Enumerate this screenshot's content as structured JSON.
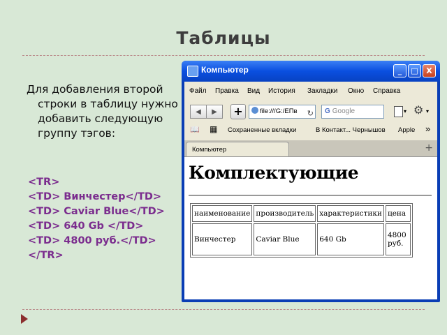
{
  "slide": {
    "title": "Таблицы",
    "intro": "Для добавления второй строки в таблицу нужно добавить следующую группу тэгов:",
    "code_lines": [
      "<TR>",
      "<TD> Винчестер</TD>",
      "<TD> Caviar Blue</TD>",
      "<TD> 640 Gb </TD>",
      "<TD> 4800 руб.</TD>",
      "</TR>"
    ]
  },
  "browser": {
    "window_title": "Компьютер",
    "window_buttons": {
      "minimize": "_",
      "maximize": "□",
      "close": "X"
    },
    "menu": [
      "Файл",
      "Правка",
      "Вид",
      "История",
      "Закладки",
      "Окно",
      "Справка"
    ],
    "nav": {
      "back": "◀",
      "forward": "▶",
      "add": "+",
      "url": "file:///G:/ЕПв",
      "reload": "↻",
      "search_placeholder": "Google",
      "search_engine_icon": "G",
      "page_menu": "▾",
      "tools_menu": "▾",
      "gear": "⚙"
    },
    "bookmarks": {
      "book_icon": "📖",
      "grid_icon": "▦",
      "items": [
        "Сохраненные вкладки",
        "В Контакт... Чернышов",
        "Apple"
      ],
      "more": "»"
    },
    "tab": {
      "label": "Компьютер",
      "new_tab": "+"
    },
    "page": {
      "heading": "Комплектующие",
      "table": {
        "headers": [
          "наименование",
          "производитель",
          "характеристики",
          "цена"
        ],
        "rows": [
          [
            "Винчестер",
            "Caviar Blue",
            "640 Gb",
            "4800 руб."
          ]
        ]
      }
    }
  }
}
